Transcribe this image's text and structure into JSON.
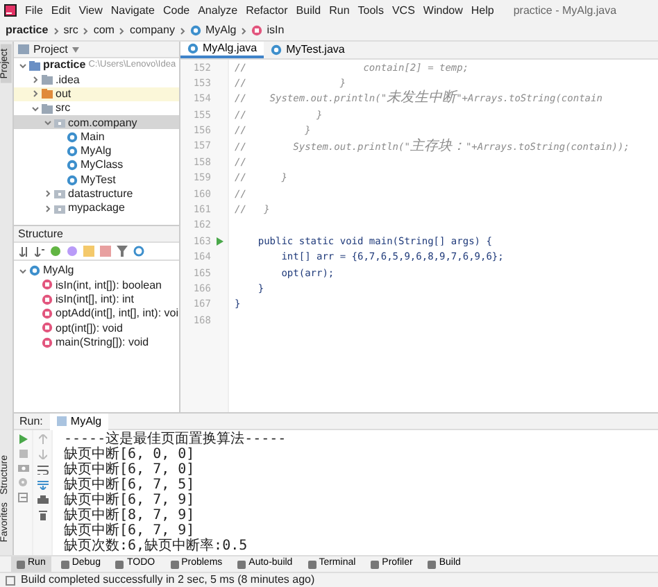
{
  "window": {
    "title": "practice - MyAlg.java"
  },
  "menu": [
    "File",
    "Edit",
    "View",
    "Navigate",
    "Code",
    "Analyze",
    "Refactor",
    "Build",
    "Run",
    "Tools",
    "VCS",
    "Window",
    "Help"
  ],
  "breadcrumb": [
    {
      "label": "practice",
      "kind": "project"
    },
    {
      "label": "src",
      "kind": "folder"
    },
    {
      "label": "com",
      "kind": "folder"
    },
    {
      "label": "company",
      "kind": "folder"
    },
    {
      "label": "MyAlg",
      "kind": "class"
    },
    {
      "label": "isIn",
      "kind": "method"
    }
  ],
  "side_stripe": {
    "top": [
      {
        "label": "Project",
        "selected": true
      }
    ],
    "bottom": [
      {
        "label": "Structure",
        "selected": false
      },
      {
        "label": "Favorites",
        "selected": false
      }
    ]
  },
  "project_panel": {
    "title": "Project",
    "tree": [
      {
        "label": "practice",
        "path": "C:\\Users\\Lenovo\\Idea",
        "kind": "project",
        "expanded": true,
        "selected": false,
        "excluded": false,
        "children": [
          {
            "label": ".idea",
            "kind": "folder",
            "expanded": false,
            "selected": false,
            "excluded": false
          },
          {
            "label": "out",
            "kind": "folder",
            "expanded": false,
            "selected": false,
            "excluded": true
          },
          {
            "label": "src",
            "kind": "folder",
            "expanded": true,
            "selected": false,
            "excluded": false,
            "children": [
              {
                "label": "com.company",
                "kind": "package",
                "expanded": true,
                "selected": true,
                "excluded": false,
                "children": [
                  {
                    "label": "Main",
                    "kind": "class",
                    "selected": false,
                    "excluded": false
                  },
                  {
                    "label": "MyAlg",
                    "kind": "class",
                    "selected": false,
                    "excluded": false
                  },
                  {
                    "label": "MyClass",
                    "kind": "class",
                    "selected": false,
                    "excluded": false
                  },
                  {
                    "label": "MyTest",
                    "kind": "class",
                    "selected": false,
                    "excluded": false
                  }
                ]
              },
              {
                "label": "datastructure",
                "kind": "package",
                "expanded": false,
                "selected": false,
                "excluded": false
              },
              {
                "label": "mypackage",
                "kind": "package",
                "expanded": false,
                "selected": false,
                "excluded": false
              }
            ]
          }
        ]
      }
    ]
  },
  "structure_panel": {
    "title": "Structure",
    "tree": [
      {
        "label": "MyAlg",
        "kind": "class",
        "expanded": true,
        "children": [
          {
            "label": "isIn(int, int[]): boolean",
            "kind": "method"
          },
          {
            "label": "isIn(int[], int): int",
            "kind": "method"
          },
          {
            "label": "optAdd(int[], int[], int): voi",
            "kind": "method"
          },
          {
            "label": "opt(int[]): void",
            "kind": "method"
          },
          {
            "label": "main(String[]): void",
            "kind": "method"
          }
        ]
      }
    ]
  },
  "editor": {
    "tabs": [
      {
        "label": "MyAlg.java",
        "selected": true
      },
      {
        "label": "MyTest.java",
        "selected": false
      }
    ],
    "lines": [
      {
        "number": "152",
        "text": "//                    contain[2] = temp;",
        "kind": "comment",
        "run_marker": false
      },
      {
        "number": "153",
        "text": "//                }",
        "kind": "comment",
        "run_marker": false
      },
      {
        "number": "154",
        "text": "//    System.out.println(\"未发生中断\"+Arrays.toString(contain",
        "kind": "comment",
        "run_marker": false
      },
      {
        "number": "155",
        "text": "//            }",
        "kind": "comment",
        "run_marker": false
      },
      {
        "number": "156",
        "text": "//          }",
        "kind": "comment",
        "run_marker": false
      },
      {
        "number": "157",
        "text": "//        System.out.println(\"主存块：\"+Arrays.toString(contain));",
        "kind": "comment",
        "run_marker": false
      },
      {
        "number": "158",
        "text": "//",
        "kind": "comment",
        "run_marker": false
      },
      {
        "number": "159",
        "text": "//      }",
        "kind": "comment",
        "run_marker": false
      },
      {
        "number": "160",
        "text": "//",
        "kind": "comment",
        "run_marker": false
      },
      {
        "number": "161",
        "text": "//   }",
        "kind": "comment",
        "run_marker": false
      },
      {
        "number": "162",
        "kind": "code",
        "run_marker": false
      },
      {
        "number": "163",
        "text": "    public static void main(String[] args) {",
        "kind": "code",
        "run_marker": true
      },
      {
        "number": "164",
        "text": "        int[] arr = {6,7,6,5,9,6,8,9,7,6,9,6};",
        "kind": "code",
        "run_marker": false
      },
      {
        "number": "165",
        "text": "        opt(arr);",
        "kind": "code",
        "run_marker": false
      },
      {
        "number": "166",
        "text": "    }",
        "kind": "code",
        "run_marker": false
      },
      {
        "number": "167",
        "text": "}",
        "kind": "code",
        "run_marker": false
      },
      {
        "number": "168",
        "kind": "code",
        "run_marker": false
      }
    ]
  },
  "run_panel": {
    "label": "Run:",
    "tab": "MyAlg",
    "output": [
      "-----这是最佳页面置换算法-----",
      "缺页中断[6, 0, 0]",
      "缺页中断[6, 7, 0]",
      "缺页中断[6, 7, 5]",
      "缺页中断[6, 7, 9]",
      "缺页中断[8, 7, 9]",
      "缺页中断[6, 7, 9]",
      "缺页次数:6,缺页中断率:0.5"
    ]
  },
  "tool_tabs": [
    {
      "label": "Run",
      "selected": true
    },
    {
      "label": "Debug",
      "selected": false
    },
    {
      "label": "TODO",
      "selected": false
    },
    {
      "label": "Problems",
      "selected": false
    },
    {
      "label": "Auto-build",
      "selected": false
    },
    {
      "label": "Terminal",
      "selected": false
    },
    {
      "label": "Profiler",
      "selected": false
    },
    {
      "label": "Build",
      "selected": false
    }
  ],
  "status_bar": {
    "text": "Build completed successfully in 2 sec, 5 ms (8 minutes ago)"
  }
}
